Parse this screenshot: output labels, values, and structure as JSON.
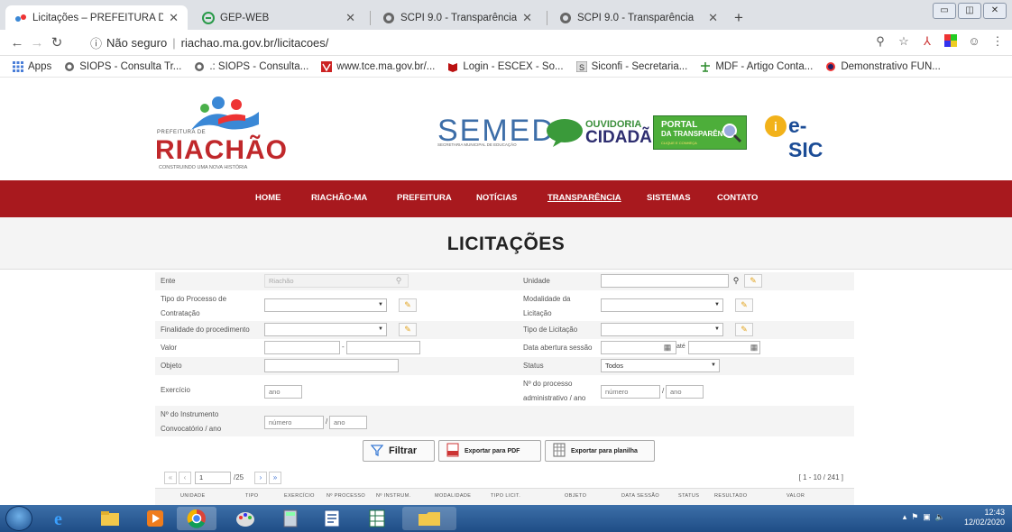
{
  "browser": {
    "tabs": [
      {
        "label": "Licitações – PREFEITURA DE RIAC",
        "active": true
      },
      {
        "label": "GEP-WEB",
        "active": false
      },
      {
        "label": "SCPI 9.0 - Transparência",
        "active": false
      },
      {
        "label": "SCPI 9.0 - Transparência",
        "active": false
      }
    ],
    "not_secure": "Não seguro",
    "url": "riachao.ma.gov.br/licitacoes/",
    "bookmarks": [
      "Apps",
      "SIOPS - Consulta Tr...",
      ".: SIOPS - Consulta...",
      "www.tce.ma.gov.br/...",
      "Login - ESCEX - So...",
      "Siconfi - Secretaria...",
      "MDF - Artigo Conta...",
      "Demonstrativo FUN..."
    ]
  },
  "site": {
    "logo": {
      "prefeitura_de": "PREFEITURA DE",
      "name": "RIACHÃO",
      "slogan": "CONSTRUINDO UMA NOVA HISTÓRIA"
    },
    "semed": {
      "title": "SEMED",
      "subtitle": "SECRETARIA MUNICIPAL DE EDUCAÇÃO"
    },
    "ouvidoria": {
      "line1": "OUVIDORIA",
      "line2": "CIDADÃ"
    },
    "portal": {
      "line1": "PORTAL",
      "line2": "DA TRANSPARÊNCIA",
      "line3": "CLIQUE E CONHEÇA"
    },
    "esic": {
      "label": "e-SIC"
    },
    "nav": [
      "HOME",
      "RIACHÃO-MA",
      "PREFEITURA",
      "NOTÍCIAS",
      "TRANSPARÊNCIA",
      "SISTEMAS",
      "CONTATO"
    ],
    "page_title": "LICITAÇÕES"
  },
  "form": {
    "ente_label": "Ente",
    "ente_value": "Riachão",
    "unidade_label": "Unidade",
    "tipo_processo_label": [
      "Tipo do Processo de",
      "Contratação"
    ],
    "modalidade_label": [
      "Modalidade da",
      "Licitação"
    ],
    "finalidade_label": "Finalidade do procedimento",
    "tipo_licitacao_label": "Tipo de Licitação",
    "valor_label": "Valor",
    "valor_sep": "-",
    "data_abertura_label": "Data abertura sessão",
    "ate": "até",
    "objeto_label": "Objeto",
    "status_label": "Status",
    "status_value": "Todos",
    "exercicio_label": "Exercício",
    "exercicio_placeholder": "ano",
    "processo_label": [
      "Nº do processo",
      "administrativo / ano"
    ],
    "numero_placeholder": "número",
    "ano_placeholder": "ano",
    "slash": "/",
    "instrumento_label": [
      "Nº do Instrumento",
      "Convocatório / ano"
    ],
    "buttons": {
      "filtrar": "Filtrar",
      "exportar_pdf": "Exportar para PDF",
      "exportar_planilha": "Exportar para planilha"
    }
  },
  "pager": {
    "current_page": "1",
    "total_pages": "/25",
    "range": "[ 1 - 10 / 241 ]"
  },
  "table": {
    "columns": [
      "UNIDADE",
      "TIPO",
      "EXERCÍCIO",
      "Nº PROCESSO",
      "Nº INSTRUM.",
      "MODALIDADE",
      "TIPO LICIT.",
      "OBJETO",
      "DATA SESSÃO",
      "STATUS",
      "RESULTADO",
      "VALOR"
    ]
  },
  "taskbar": {
    "time": "12:43",
    "date": "12/02/2020"
  }
}
